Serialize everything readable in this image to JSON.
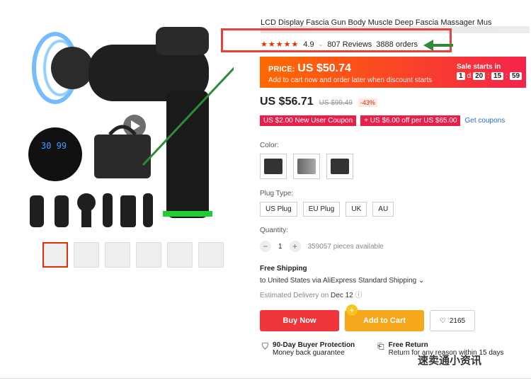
{
  "product": {
    "title": "LCD Display Fascia Gun Body Muscle Deep Fascia Massager Mus"
  },
  "rating": {
    "stars": "★★★★★",
    "score": "4.9",
    "reviews": "807 Reviews",
    "orders": "3888 orders"
  },
  "promo": {
    "price_label": "PRICE:",
    "price": "US $50.74",
    "subtitle": "Add to cart now and order later when discount starts",
    "sale_label": "Sale starts in",
    "days": "1",
    "day_label": "d",
    "hours": "20",
    "minutes": "15",
    "seconds": "59"
  },
  "price": {
    "current": "US $56.71",
    "original": "US $99.49",
    "discount": "-43%"
  },
  "coupons": {
    "new_user": "US $2.00 New User Coupon",
    "spend": "+ US $6.00 off per US $65.00",
    "get_coupons": "Get coupons"
  },
  "color": {
    "label": "Color:"
  },
  "plug": {
    "label": "Plug Type:",
    "options": [
      "US Plug",
      "EU Plug",
      "UK",
      "AU"
    ]
  },
  "quantity": {
    "label": "Quantity:",
    "minus": "−",
    "value": "1",
    "plus": "+",
    "available": "359057 pieces available"
  },
  "shipping": {
    "title": "Free Shipping",
    "to": "to United States via AliExpress Standard Shipping ⌄",
    "eta_label": "Estimated Delivery on",
    "eta_date": "Dec 12"
  },
  "actions": {
    "buy_now": "Buy Now",
    "add_to_cart": "Add to Cart",
    "wishlist_count": "2165"
  },
  "guarantees": {
    "protection_title": "90-Day Buyer Protection",
    "protection_sub": "Money back guarantee",
    "return_title": "Free Return",
    "return_sub": "Return for any reason within 15 days"
  },
  "watermark": "速卖通小资讯",
  "colors": {
    "accent_red": "#e62e04",
    "buy_red": "#f0353b",
    "cart_orange": "#f6a81d",
    "annotation_green": "#2e8b3a"
  }
}
